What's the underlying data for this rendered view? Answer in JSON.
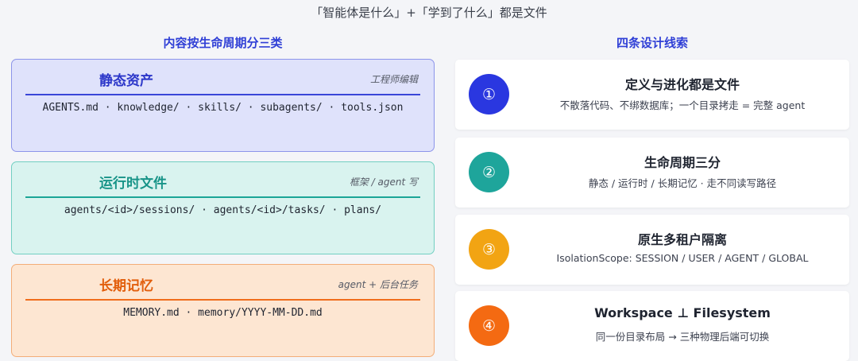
{
  "top_title": "「智能体是什么」+「学到了什么」都是文件",
  "left_header": "内容按生命周期分三类",
  "right_header": "四条设计线索",
  "panels": [
    {
      "title": "静态资产",
      "tag": "工程师编辑",
      "files": "AGENTS.md · knowledge/ · skills/ · subagents/ · tools.json",
      "colors": {
        "bg": "#dfe2fb",
        "border": "#8c94ea",
        "accent": "#3a46d8"
      }
    },
    {
      "title": "运行时文件",
      "tag": "框架 / agent 写",
      "files": "agents/<id>/sessions/ · agents/<id>/tasks/ · plans/",
      "colors": {
        "bg": "#d9f3ef",
        "border": "#72cfc2",
        "accent": "#1ba596"
      }
    },
    {
      "title": "长期记忆",
      "tag": "agent + 后台任务",
      "files": "MEMORY.md · memory/YYYY-MM-DD.md",
      "colors": {
        "bg": "#fde6d2",
        "border": "#f3ad78",
        "accent": "#f06d1c"
      }
    }
  ],
  "cards": [
    {
      "badge": "①",
      "title": "定义与进化都是文件",
      "desc": "不散落代码、不绑数据库；一个目录拷走 = 完整 agent",
      "color": "#2a37e0"
    },
    {
      "badge": "②",
      "title": "生命周期三分",
      "desc": "静态 / 运行时 / 长期记忆 · 走不同读写路径",
      "color": "#1ea59b"
    },
    {
      "badge": "③",
      "title": "原生多租户隔离",
      "desc": "IsolationScope: SESSION / USER / AGENT / GLOBAL",
      "color": "#f2a413"
    },
    {
      "badge": "④",
      "title": "Workspace ⊥ Filesystem",
      "desc": "同一份目录布局 → 三种物理后端可切换",
      "color": "#f46a12"
    }
  ]
}
